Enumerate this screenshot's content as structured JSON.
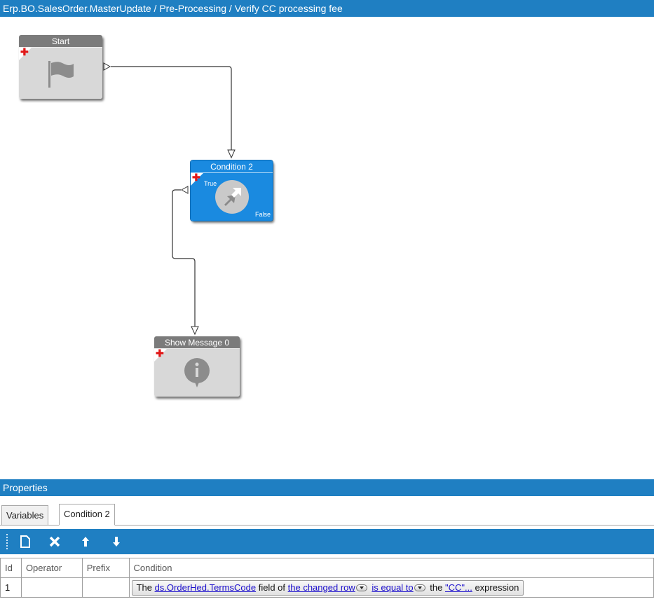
{
  "window": {
    "breadcrumb": "Erp.BO.SalesOrder.MasterUpdate / Pre-Processing / Verify CC processing fee"
  },
  "canvas": {
    "nodes": {
      "start": {
        "title": "Start",
        "icon": "flag-icon"
      },
      "condition": {
        "title": "Condition 2",
        "true_label": "True",
        "false_label": "False",
        "icon": "condition-arrows-icon",
        "color": "#1a8ae0"
      },
      "message": {
        "title": "Show Message 0",
        "icon": "info-bubble-icon"
      }
    }
  },
  "properties": {
    "title": "Properties",
    "tabs": [
      {
        "label": "Variables",
        "active": false
      },
      {
        "label": "Condition 2",
        "active": true
      }
    ],
    "toolbar": {
      "buttons": [
        "new-icon",
        "delete-icon",
        "move-up-icon",
        "move-down-icon"
      ]
    },
    "grid": {
      "columns": [
        "Id",
        "Operator",
        "Prefix",
        "Condition"
      ],
      "rows": [
        {
          "id": "1",
          "operator": "",
          "prefix": "",
          "condition": {
            "text_the": "The",
            "field_link": "ds.OrderHed.TermsCode",
            "text_field_of": "field of",
            "row_link": "the changed row",
            "operator_link": "is equal to",
            "text_the2": "the",
            "value_link": "\"CC\"...",
            "text_expression": "expression"
          }
        }
      ]
    }
  },
  "colors": {
    "accent": "#1f7fc2",
    "node_gray": "#d8d8d8",
    "node_header_gray": "#7b7b7b",
    "add_plus": "#e01818"
  }
}
